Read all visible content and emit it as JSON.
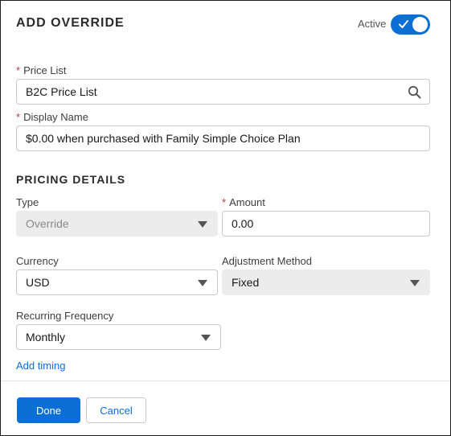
{
  "header": {
    "title": "ADD OVERRIDE",
    "active_label": "Active",
    "active_on": true
  },
  "form": {
    "price_list": {
      "label": "Price List",
      "value": "B2C Price List"
    },
    "display_name": {
      "label": "Display Name",
      "value": "$0.00 when purchased with Family Simple Choice Plan"
    }
  },
  "pricing": {
    "section_title": "PRICING DETAILS",
    "type": {
      "label": "Type",
      "value": "Override"
    },
    "amount": {
      "label": "Amount",
      "value": "0.00"
    },
    "currency": {
      "label": "Currency",
      "value": "USD"
    },
    "adjustment_method": {
      "label": "Adjustment Method",
      "value": "Fixed"
    },
    "recurring_frequency": {
      "label": "Recurring Frequency",
      "value": "Monthly"
    },
    "add_timing": "Add timing"
  },
  "footer": {
    "done_label": "Done",
    "cancel_label": "Cancel"
  },
  "colors": {
    "accent": "#0b6fd6",
    "required": "#c23934",
    "disabled_bg": "#ececec"
  }
}
